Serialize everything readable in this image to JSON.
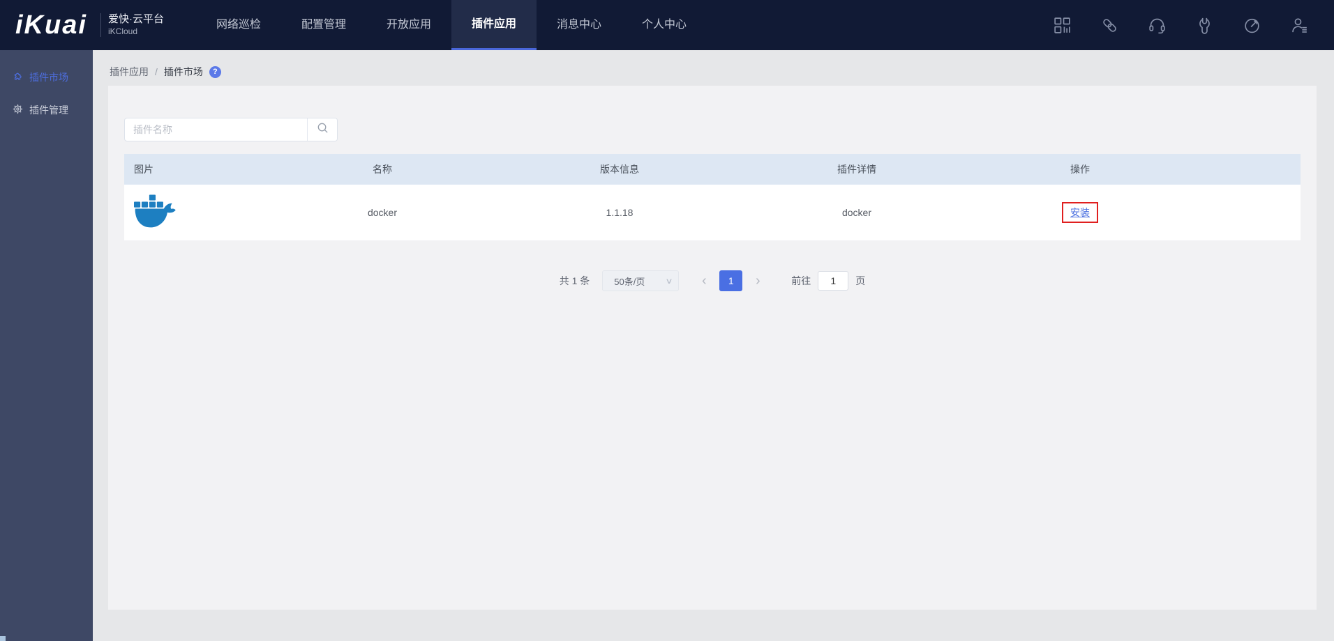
{
  "brand": {
    "logo_text": "iKuai",
    "platform_name": "爱快·云平台",
    "platform_sub": "iKCloud"
  },
  "navbar": {
    "items": [
      {
        "label": "网络巡检",
        "active": false
      },
      {
        "label": "配置管理",
        "active": false
      },
      {
        "label": "开放应用",
        "active": false
      },
      {
        "label": "插件应用",
        "active": true
      },
      {
        "label": "消息中心",
        "active": false
      },
      {
        "label": "个人中心",
        "active": false
      }
    ],
    "icons": [
      "apps-grid-icon",
      "link-icon",
      "headset-icon",
      "wrench-icon",
      "gauge-icon",
      "user-menu-icon"
    ]
  },
  "sidebar": {
    "items": [
      {
        "label": "插件市场",
        "icon": "puzzle-icon",
        "active": true
      },
      {
        "label": "插件管理",
        "icon": "gear-icon",
        "active": false
      }
    ]
  },
  "breadcrumb": {
    "parent": "插件应用",
    "separator": "/",
    "current": "插件市场",
    "help_glyph": "?"
  },
  "search": {
    "placeholder": "插件名称"
  },
  "table": {
    "columns": [
      "图片",
      "名称",
      "版本信息",
      "插件详情",
      "操作"
    ],
    "rows": [
      {
        "image": "docker-logo",
        "name": "docker",
        "version": "1.1.18",
        "detail": "docker",
        "action": "安装"
      }
    ]
  },
  "pagination": {
    "total_text": "共 1 条",
    "page_size": "50条/页",
    "size_chevron": "∨",
    "prev_glyph": "‹",
    "current_page": "1",
    "next_glyph": "›",
    "goto_label": "前往",
    "goto_value": "1",
    "goto_unit": "页"
  },
  "colors": {
    "navbar_bg": "#111a35",
    "sidebar_bg": "#3e4865",
    "accent_blue": "#4a6fe3",
    "table_header_bg": "#dde7f3",
    "docker_blue": "#1d7fc1",
    "annotation_red": "#e01f1f"
  }
}
